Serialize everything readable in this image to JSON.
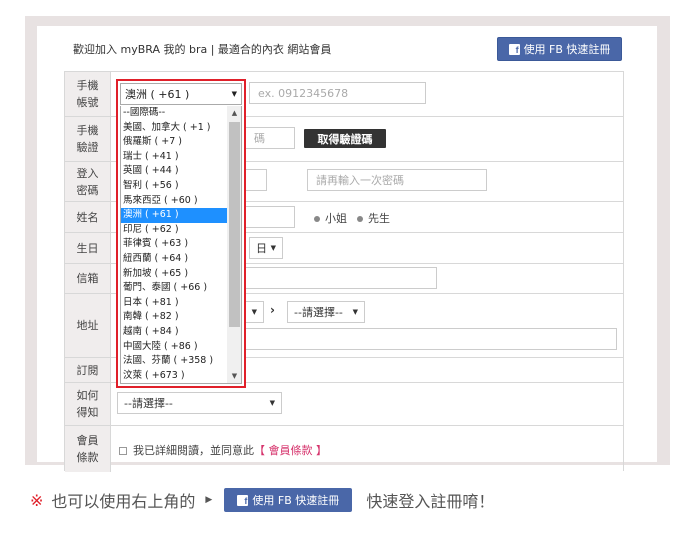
{
  "header": {
    "welcome": "歡迎加入 myBRA 我的 bra | 最適合的內衣 網站會員",
    "fb_button": "使用 FB 快速註冊"
  },
  "form": {
    "phone": {
      "label": "手機\n帳號",
      "selected": "澳洲 ( +61 )",
      "placeholder": "ex. 0912345678"
    },
    "verify": {
      "label": "手機\n驗證",
      "partial_placeholder": "碼",
      "button": "取得驗證碼"
    },
    "password": {
      "label": "登入\n密碼",
      "confirm_placeholder": "請再輸入一次密碼"
    },
    "name": {
      "label": "姓名",
      "option_female": "小姐",
      "option_male": "先生"
    },
    "birthday": {
      "label": "生日",
      "day": "日"
    },
    "email": {
      "label": "信箱"
    },
    "address": {
      "label": "地址",
      "district": "--請選擇--"
    },
    "subscribe": {
      "label": "訂閱"
    },
    "source": {
      "label": "如何\n得知",
      "value": "--請選擇--"
    },
    "terms": {
      "label": "會員\n條款",
      "text": "我已詳細閱讀，並同意此",
      "link": "【 會員條款 】"
    }
  },
  "dropdown": {
    "selected": "澳洲 ( +61 )",
    "options": [
      "--國際碼--",
      "美國、加拿大 ( +1 )",
      "俄羅斯 ( +7 )",
      "瑞士 ( +41 )",
      "英國 ( +44 )",
      "智利 ( +56 )",
      "馬來西亞 ( +60 )",
      "澳洲 ( +61 )",
      "印尼 ( +62 )",
      "菲律賓 ( +63 )",
      "紐西蘭 ( +64 )",
      "新加坡 ( +65 )",
      "葡門、泰國 ( +66 )",
      "日本 ( +81 )",
      "南韓 ( +82 )",
      "越南 ( +84 )",
      "中國大陸 ( +86 )",
      "法國、芬蘭 ( +358 )",
      "汶萊 ( +673 )"
    ],
    "selected_index": 7
  },
  "footer": {
    "mark": "※",
    "text_before": "也可以使用右上角的",
    "fb_button": "使用 FB 快速註冊",
    "text_after": "快速登入註冊唷！"
  },
  "colors": {
    "accent_red": "#e0202a",
    "fb_blue": "#4a67a8",
    "link_pink": "#d6336c"
  }
}
